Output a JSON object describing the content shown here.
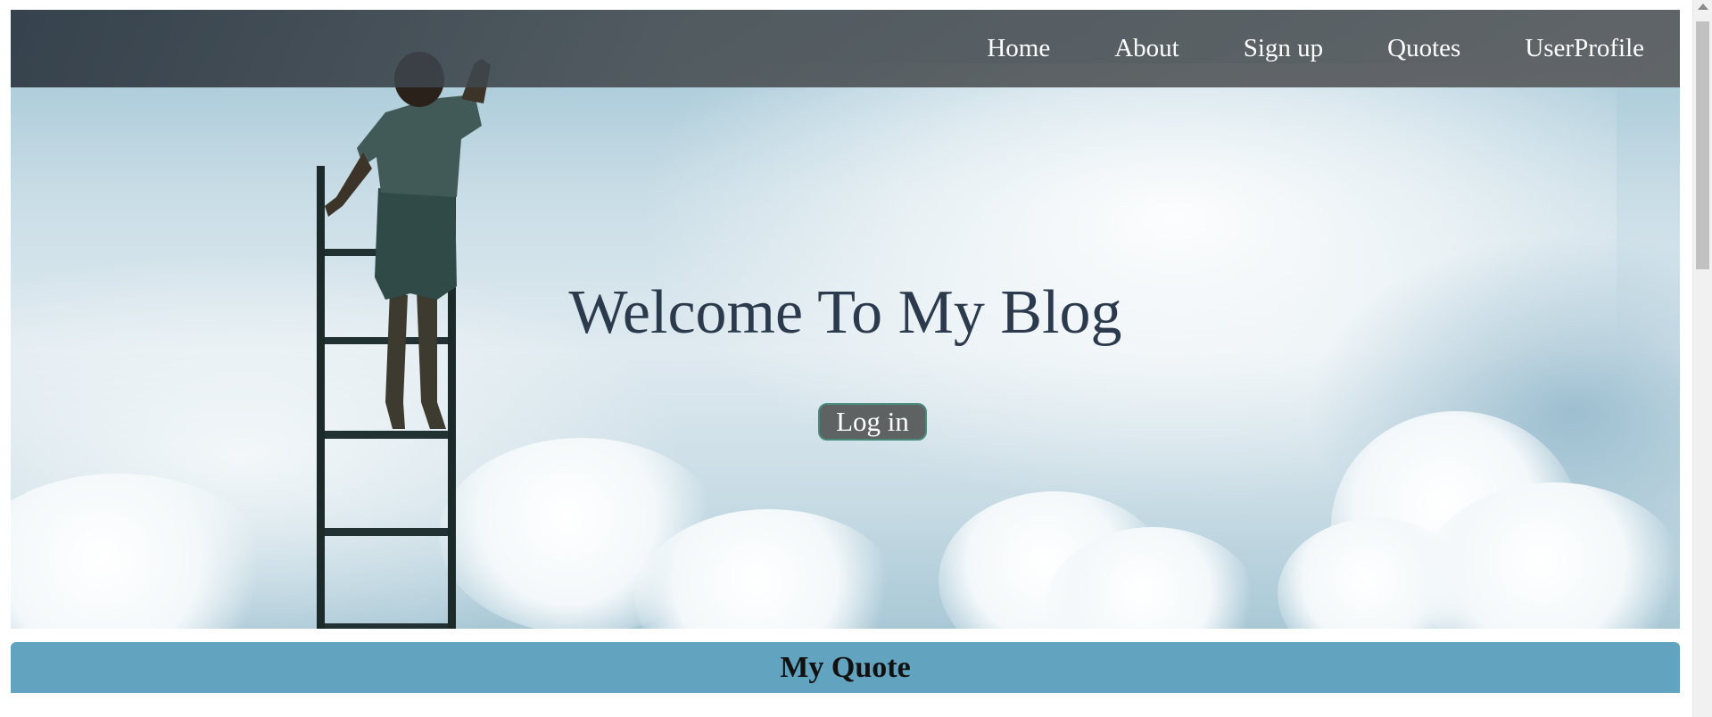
{
  "nav": {
    "items": [
      {
        "label": "Home"
      },
      {
        "label": "About"
      },
      {
        "label": "Sign up"
      },
      {
        "label": "Quotes"
      },
      {
        "label": "UserProfile"
      }
    ]
  },
  "hero": {
    "title": "Welcome To My Blog",
    "login_label": "Log in"
  },
  "quote_section": {
    "title": "My Quote"
  },
  "colors": {
    "nav_bg": "#474d52",
    "title_text": "#2b3a4c",
    "login_bg": "#5f6263",
    "quote_bar": "#62a4bf"
  }
}
